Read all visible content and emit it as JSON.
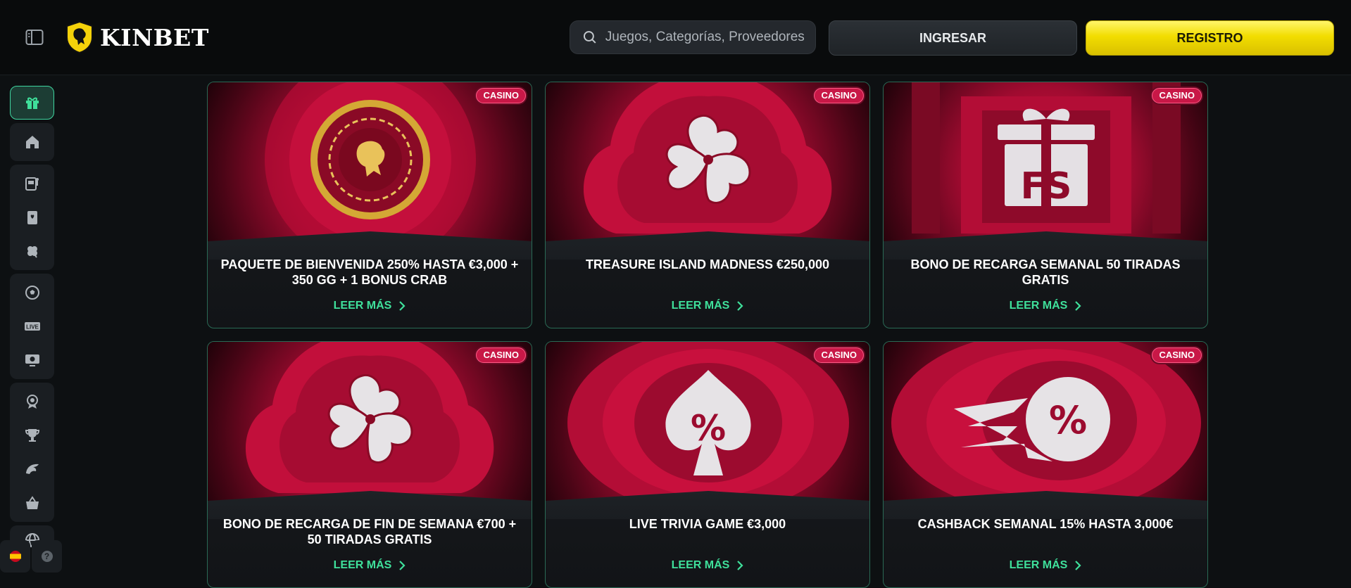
{
  "header": {
    "logo_text": "KINBET",
    "search_placeholder": "Juegos, Categorías, Proveedores",
    "login_label": "INGRESAR",
    "register_label": "REGISTRO"
  },
  "colors": {
    "accent_green": "#3fe09b",
    "register_yellow": "#f2dd00",
    "badge_red": "#c81847",
    "card_art_red": "#d8103e"
  },
  "sidebar": {
    "items": [
      {
        "icon": "gift-icon",
        "active": true
      },
      {
        "icon": "home-icon"
      },
      {
        "icon": "slot-machine-icon"
      },
      {
        "icon": "cards-icon"
      },
      {
        "icon": "clover-icon"
      },
      {
        "icon": "soccer-ball-icon"
      },
      {
        "icon": "live-icon",
        "label": "LIVE"
      },
      {
        "icon": "virtual-sports-icon"
      },
      {
        "icon": "vip-badge-icon"
      },
      {
        "icon": "trophy-icon"
      },
      {
        "icon": "fantasy-icon"
      },
      {
        "icon": "shop-basket-icon"
      },
      {
        "icon": "globe-icon"
      }
    ],
    "footer": {
      "language_flag": "spain-flag-icon",
      "help_label": "?"
    }
  },
  "promotions": [
    {
      "badge": "CASINO",
      "title": "PAQUETE DE BIENVENIDA 250% HASTA €3,000 + 350 GG + 1 BONUS CRAB",
      "link": "LEER MÁS",
      "art": "casino-chip"
    },
    {
      "badge": "CASINO",
      "title": "TREASURE ISLAND MADNESS €250,000",
      "link": "LEER MÁS",
      "art": "clover"
    },
    {
      "badge": "CASINO",
      "title": "BONO DE RECARGA SEMANAL 50 TIRADAS GRATIS",
      "link": "LEER MÁS",
      "art": "gift-fs"
    },
    {
      "badge": "CASINO",
      "title": "BONO DE RECARGA DE FIN DE SEMANA €700 + 50 TIRADAS GRATIS",
      "link": "LEER MÁS",
      "art": "clover"
    },
    {
      "badge": "CASINO",
      "title": "LIVE TRIVIA GAME €3,000",
      "link": "LEER MÁS",
      "art": "spade-percent"
    },
    {
      "badge": "CASINO",
      "title": "CASHBACK SEMANAL 15% HASTA 3,000€",
      "link": "LEER MÁS",
      "art": "speed-percent"
    }
  ]
}
